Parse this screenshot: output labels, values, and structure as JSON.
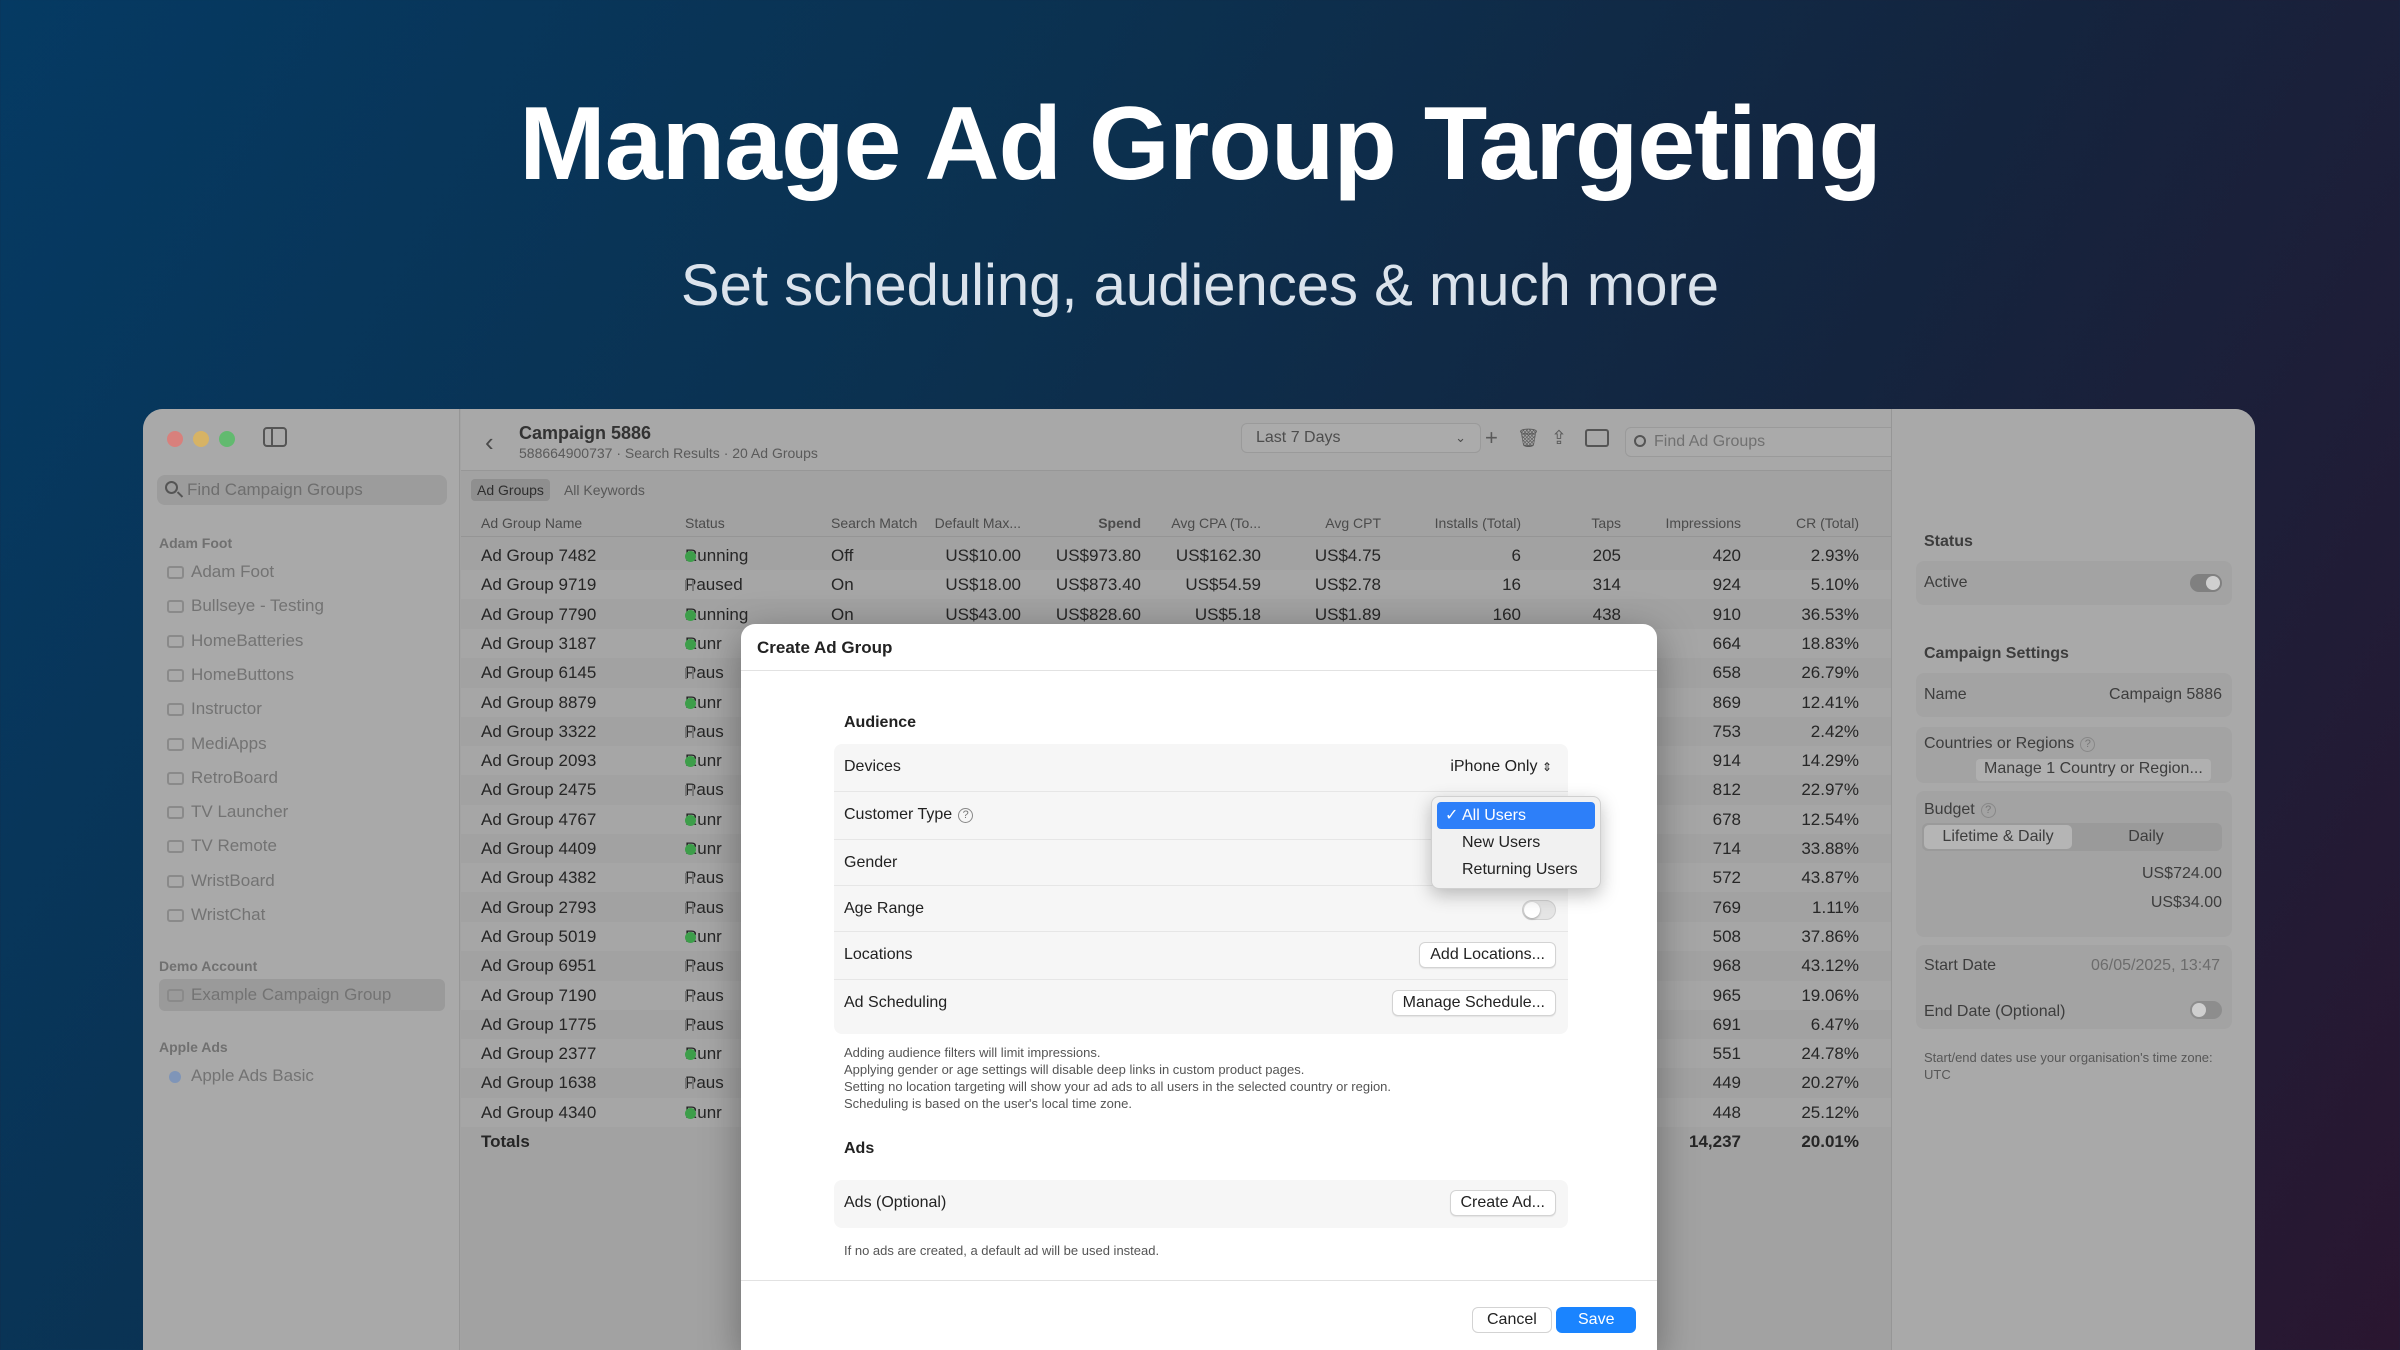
{
  "hero": {
    "title": "Manage Ad Group Targeting",
    "subtitle": "Set scheduling, audiences & much more"
  },
  "sidebar": {
    "search_placeholder": "Find Campaign Groups",
    "sections": [
      {
        "title": "Adam Foot",
        "items": [
          "Adam Foot",
          "Bullseye - Testing",
          "HomeBatteries",
          "HomeButtons",
          "Instructor",
          "MediApps",
          "RetroBoard",
          "TV Launcher",
          "TV Remote",
          "WristBoard",
          "WristChat"
        ]
      },
      {
        "title": "Demo Account",
        "items": [
          "Example Campaign Group"
        ]
      },
      {
        "title": "Apple Ads",
        "items": [
          "Apple Ads Basic"
        ]
      }
    ]
  },
  "toolbar": {
    "title": "Campaign 5886",
    "subtitle": "588664900737 · Search Results · 20 Ad Groups",
    "date_range": "Last 7 Days",
    "search_placeholder": "Find Ad Groups"
  },
  "tabs": [
    "Ad Groups",
    "All Keywords"
  ],
  "table": {
    "columns": [
      "Ad Group Name",
      "Status",
      "Search Match",
      "Default Max...",
      "Spend",
      "Avg CPA (To...",
      "Avg CPT",
      "Installs (Total)",
      "Taps",
      "Impressions",
      "CR (Total)"
    ],
    "rows": [
      [
        "Ad Group 7482",
        "Running",
        "Off",
        "US$10.00",
        "US$973.80",
        "US$162.30",
        "US$4.75",
        "6",
        "205",
        "420",
        "2.93%"
      ],
      [
        "Ad Group 9719",
        "Paused",
        "On",
        "US$18.00",
        "US$873.40",
        "US$54.59",
        "US$2.78",
        "16",
        "314",
        "924",
        "5.10%"
      ],
      [
        "Ad Group 7790",
        "Running",
        "On",
        "US$43.00",
        "US$828.60",
        "US$5.18",
        "US$1.89",
        "160",
        "438",
        "910",
        "36.53%"
      ],
      [
        "Ad Group 3187",
        "Runr",
        "",
        "",
        "",
        "",
        "",
        "",
        "",
        "664",
        "18.83%"
      ],
      [
        "Ad Group 6145",
        "Paus",
        "",
        "",
        "",
        "",
        "",
        "",
        "",
        "658",
        "26.79%"
      ],
      [
        "Ad Group 8879",
        "Runr",
        "",
        "",
        "",
        "",
        "",
        "",
        "",
        "869",
        "12.41%"
      ],
      [
        "Ad Group 3322",
        "Paus",
        "",
        "",
        "",
        "",
        "",
        "",
        "",
        "753",
        "2.42%"
      ],
      [
        "Ad Group 2093",
        "Runr",
        "",
        "",
        "",
        "",
        "",
        "",
        "",
        "914",
        "14.29%"
      ],
      [
        "Ad Group 2475",
        "Paus",
        "",
        "",
        "",
        "",
        "",
        "",
        "",
        "812",
        "22.97%"
      ],
      [
        "Ad Group 4767",
        "Runr",
        "",
        "",
        "",
        "",
        "",
        "",
        "",
        "678",
        "12.54%"
      ],
      [
        "Ad Group 4409",
        "Runr",
        "",
        "",
        "",
        "",
        "",
        "",
        "",
        "714",
        "33.88%"
      ],
      [
        "Ad Group 4382",
        "Paus",
        "",
        "",
        "",
        "",
        "",
        "",
        "",
        "572",
        "43.87%"
      ],
      [
        "Ad Group 2793",
        "Paus",
        "",
        "",
        "",
        "",
        "",
        "",
        "",
        "769",
        "1.11%"
      ],
      [
        "Ad Group 5019",
        "Runr",
        "",
        "",
        "",
        "",
        "",
        "",
        "",
        "508",
        "37.86%"
      ],
      [
        "Ad Group 6951",
        "Paus",
        "",
        "",
        "",
        "",
        "",
        "",
        "",
        "968",
        "43.12%"
      ],
      [
        "Ad Group 7190",
        "Paus",
        "",
        "",
        "",
        "",
        "",
        "",
        "",
        "965",
        "19.06%"
      ],
      [
        "Ad Group 1775",
        "Paus",
        "",
        "",
        "",
        "",
        "",
        "",
        "",
        "691",
        "6.47%"
      ],
      [
        "Ad Group 2377",
        "Runr",
        "",
        "",
        "",
        "",
        "",
        "",
        "",
        "551",
        "24.78%"
      ],
      [
        "Ad Group 1638",
        "Paus",
        "",
        "",
        "",
        "",
        "",
        "",
        "",
        "449",
        "20.27%"
      ],
      [
        "Ad Group 4340",
        "Runr",
        "",
        "",
        "",
        "",
        "",
        "",
        "",
        "448",
        "25.12%"
      ]
    ],
    "totals": {
      "label": "Totals",
      "impressions": "14,237",
      "cr": "20.01%"
    }
  },
  "inspector": {
    "status_header": "Status",
    "active_label": "Active",
    "settings_header": "Campaign Settings",
    "name_label": "Name",
    "name_value": "Campaign 5886",
    "countries_label": "Countries or Regions",
    "countries_button": "Manage 1 Country or Region...",
    "budget_label": "Budget",
    "budget_segments": [
      "Lifetime & Daily",
      "Daily"
    ],
    "budget_lifetime": "US$724.00",
    "budget_daily": "US$34.00",
    "start_label": "Start Date",
    "start_value": "06/05/2025, 13:47",
    "end_label": "End Date (Optional)",
    "note": "Start/end dates use your organisation's time zone: UTC"
  },
  "dialog": {
    "title": "Create Ad Group",
    "audience_header": "Audience",
    "devices_label": "Devices",
    "devices_value": "iPhone Only",
    "customer_type_label": "Customer Type",
    "gender_label": "Gender",
    "age_label": "Age Range",
    "locations_label": "Locations",
    "locations_button": "Add Locations...",
    "scheduling_label": "Ad Scheduling",
    "scheduling_button": "Manage Schedule...",
    "audience_notes": [
      "Adding audience filters will limit impressions.",
      "Applying gender or age settings will disable deep links in custom product pages.",
      "Setting no location targeting will show your ad ads to all users in the selected country or region.",
      "Scheduling is based on the user's local time zone."
    ],
    "ads_header": "Ads",
    "ads_label": "Ads (Optional)",
    "ads_button": "Create Ad...",
    "ads_note": "If no ads are created, a default ad will be used instead.",
    "cancel": "Cancel",
    "save": "Save"
  },
  "popup": {
    "options": [
      "All Users",
      "New Users",
      "Returning Users"
    ],
    "selected": "All Users",
    "check": "✓"
  },
  "colors": {
    "accent": "#1a84ff",
    "running": "#3d9e4a",
    "close": "#ff5f57",
    "minimize": "#febc2e",
    "zoom": "#28c840"
  }
}
